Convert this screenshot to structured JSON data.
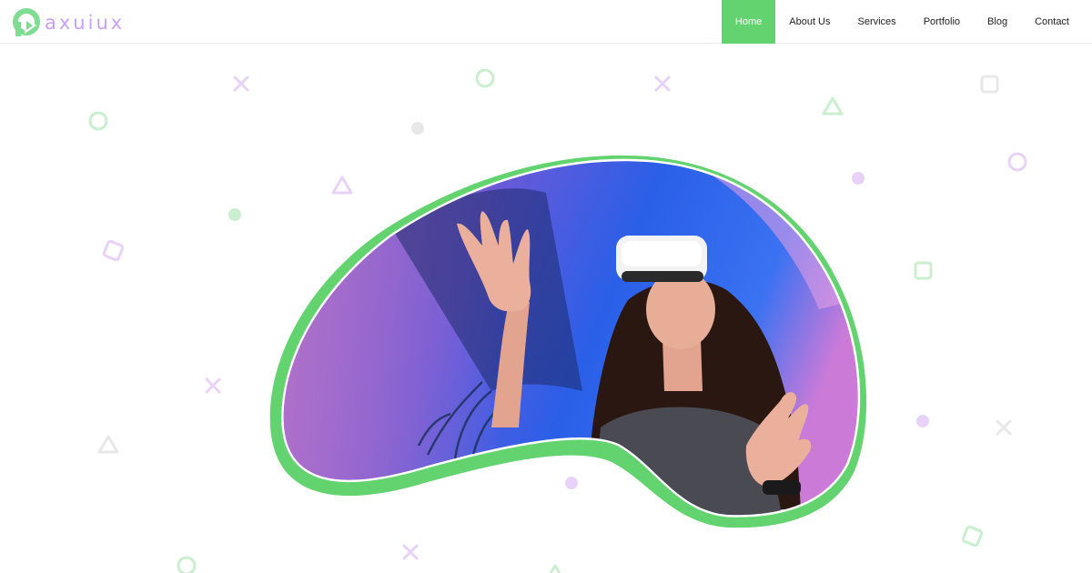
{
  "brand": {
    "logo_text": "axuiux",
    "logo_mark_color": "#7fdc93",
    "logo_text_color": "#c9a1f2"
  },
  "nav": {
    "items": [
      {
        "label": "Home",
        "active": true
      },
      {
        "label": "About Us",
        "active": false
      },
      {
        "label": "Services",
        "active": false
      },
      {
        "label": "Portfolio",
        "active": false
      },
      {
        "label": "Blog",
        "active": false
      },
      {
        "label": "Contact",
        "active": false
      }
    ]
  },
  "colors": {
    "accent_green": "#62d36f",
    "shape_green": "#c9efcf",
    "shape_purple": "#e9d2f8",
    "shape_gray": "#e8e8e8"
  },
  "hero": {
    "image_subject": "woman-wearing-vr-headset",
    "frame_color": "#62d36f"
  }
}
